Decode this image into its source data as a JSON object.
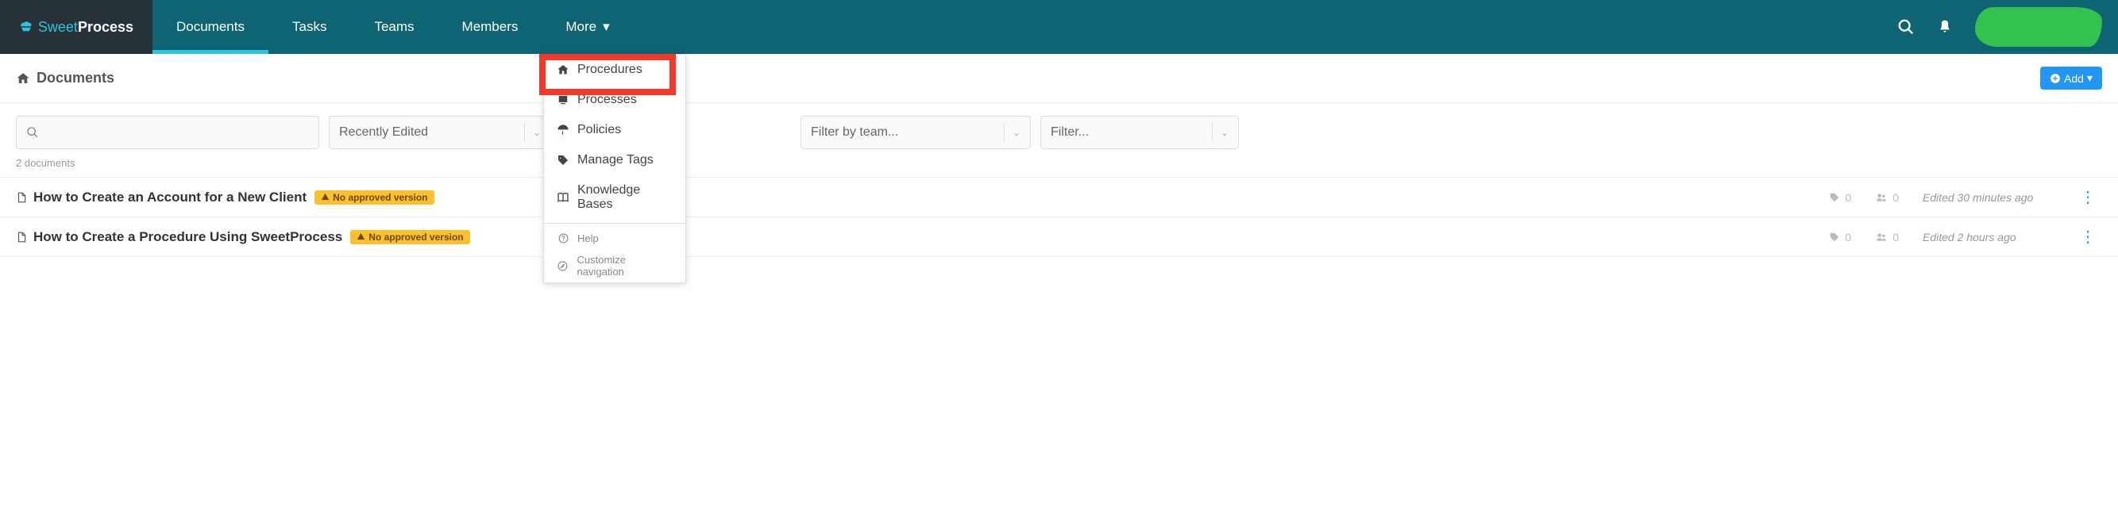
{
  "logo": {
    "sweet": "Sweet",
    "process": "Process"
  },
  "nav": {
    "documents": "Documents",
    "tasks": "Tasks",
    "teams": "Teams",
    "members": "Members",
    "more": "More"
  },
  "more_menu": {
    "procedures": "Procedures",
    "processes": "Processes",
    "policies": "Policies",
    "manage_tags": "Manage Tags",
    "knowledge_bases": "Knowledge Bases",
    "help": "Help",
    "customize_nav": "Customize navigation"
  },
  "breadcrumb": "Documents",
  "add_button": "Add",
  "filters": {
    "sort": "Recently Edited",
    "team_placeholder": "Filter by team...",
    "filter_placeholder": "Filter..."
  },
  "doc_count": "2 documents",
  "badge_text": "No approved version",
  "docs": [
    {
      "title": "How to Create an Account for a New Client",
      "tags": "0",
      "watchers": "0",
      "edited": "Edited 30 minutes ago"
    },
    {
      "title": "How to Create a Procedure Using SweetProcess",
      "tags": "0",
      "watchers": "0",
      "edited": "Edited 2 hours ago"
    }
  ]
}
